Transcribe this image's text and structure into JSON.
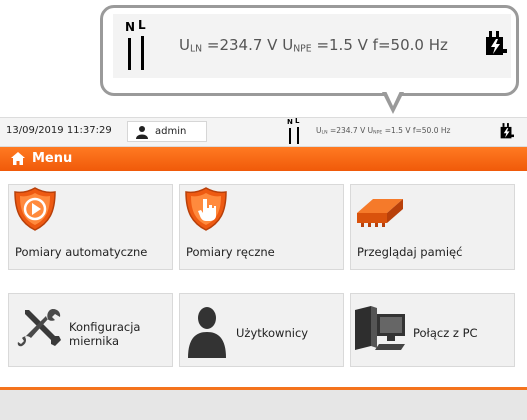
{
  "callout": {
    "phase_n": "N",
    "phase_l": "L",
    "uln_value": "=234.7 V",
    "unpe_value": "=1.5 V",
    "freq": "f=50.0 Hz",
    "uln_sub": "LN",
    "unpe_sub": "NPE",
    "u_symbol": "U"
  },
  "statusbar": {
    "datetime": "13/09/2019 11:37:29",
    "user": "admin",
    "phase_n": "N",
    "phase_l": "L",
    "u_symbol": "U",
    "uln_sub": "LN",
    "uln_value": "=234.7 V",
    "unpe_sub": "NPE",
    "unpe_value": "=1.5 V",
    "freq": "f=50.0 Hz",
    "user_icon": "user-icon",
    "plug_icon": "plug-icon"
  },
  "menubar": {
    "title": "Menu",
    "icon": "home-icon"
  },
  "tiles": [
    {
      "label": "Pomiary automatyczne",
      "icon": "auto-measure-shield-icon"
    },
    {
      "label": "Pomiary ręczne",
      "icon": "manual-measure-shield-icon"
    },
    {
      "label": "Przeglądaj pamięć",
      "icon": "memory-icon"
    },
    {
      "label": "Konfiguracja miernika",
      "icon": "tools-icon"
    },
    {
      "label": "Użytkownicy",
      "icon": "users-icon"
    },
    {
      "label": "Połącz z PC",
      "icon": "pc-icon"
    }
  ],
  "colors": {
    "accent": "#f4731d",
    "tile_bg": "#f1f1f1",
    "icon_orange": "#ee5a12"
  }
}
